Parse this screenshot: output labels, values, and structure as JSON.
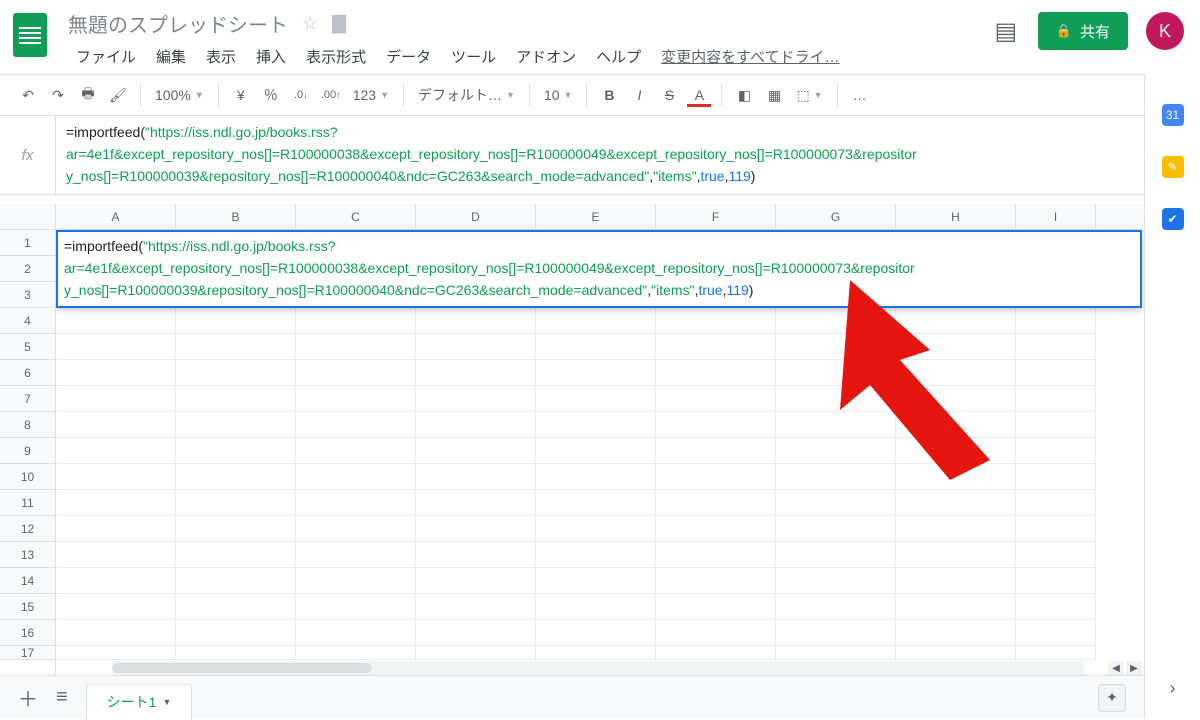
{
  "doc": {
    "title": "無題のスプレッドシート",
    "avatar_initial": "K"
  },
  "menus": {
    "file": "ファイル",
    "edit": "編集",
    "view": "表示",
    "insert": "挿入",
    "format": "表示形式",
    "data": "データ",
    "tools": "ツール",
    "addons": "アドオン",
    "help": "ヘルプ",
    "lastedit": "変更内容をすべてドライ…"
  },
  "share": {
    "label": "共有"
  },
  "toolbar": {
    "zoom": "100%",
    "currency": "¥",
    "percent": "％",
    "dec_dec": ".0",
    "dec_inc": ".00",
    "more_fmt": "123",
    "font": "デフォルト…",
    "size": "10",
    "bold": "B",
    "italic": "I",
    "strike": "S",
    "textA": "A",
    "more": "…"
  },
  "cols": [
    "A",
    "B",
    "C",
    "D",
    "E",
    "F",
    "G",
    "H",
    "I"
  ],
  "rows": [
    "1",
    "2",
    "3",
    "4",
    "5",
    "6",
    "7",
    "8",
    "9",
    "10",
    "11",
    "12",
    "13",
    "14",
    "15",
    "16",
    "17"
  ],
  "sheet_tab": "シート1",
  "formula": {
    "head": "=importfeed(",
    "url_l1": "\"https://iss.ndl.go.jp/books.rss?",
    "url_l2": "ar=4e1f&except_repository_nos[]=R100000038&except_repository_nos[]=R100000049&except_repository_nos[]=R100000073&repositor",
    "url_l3": "y_nos[]=R100000039&repository_nos[]=R100000040&ndc=GC263&search_mode=advanced\"",
    "sep1": ",",
    "arg_items": "\"items\"",
    "sep2": ",",
    "arg_true": "true",
    "sep3": ",",
    "arg_num": "119",
    "tail": ")"
  }
}
